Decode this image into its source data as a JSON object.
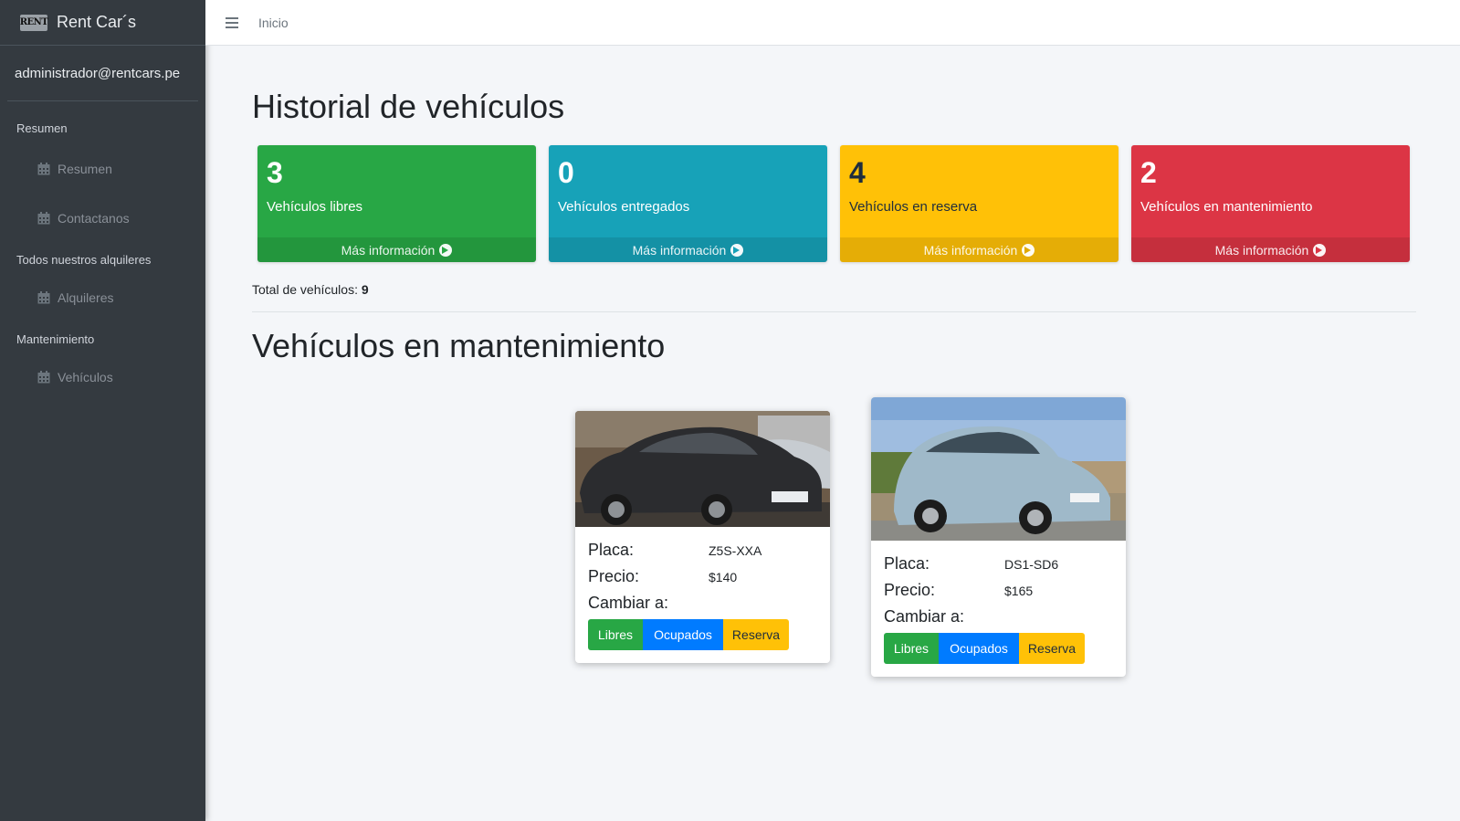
{
  "brand": {
    "logo_text": "RENT",
    "name": "Rent Car´s"
  },
  "user": {
    "email": "administrador@rentcars.pe"
  },
  "nav": {
    "sections": [
      {
        "header": "Resumen",
        "items": [
          {
            "label": "Resumen",
            "icon": "calendar-icon"
          },
          {
            "label": "Contactanos",
            "icon": "calendar-icon"
          }
        ]
      },
      {
        "header": "Todos nuestros alquileres",
        "items": [
          {
            "label": "Alquileres",
            "icon": "calendar-icon"
          }
        ]
      },
      {
        "header": "Mantenimiento",
        "items": [
          {
            "label": "Vehículos",
            "icon": "calendar-icon"
          }
        ]
      }
    ]
  },
  "topbar": {
    "menu_icon": "hamburger-icon",
    "link": "Inicio"
  },
  "page": {
    "title": "Historial de vehículos",
    "stats": [
      {
        "value": "3",
        "label": "Vehículos libres",
        "footer": "Más información",
        "color": "#28a745"
      },
      {
        "value": "0",
        "label": "Vehículos entregados",
        "footer": "Más información",
        "color": "#17a2b8"
      },
      {
        "value": "4",
        "label": "Vehículos en reserva",
        "footer": "Más información",
        "color": "#ffc107"
      },
      {
        "value": "2",
        "label": "Vehículos en mantenimiento",
        "footer": "Más información",
        "color": "#dc3545"
      }
    ],
    "total_label": "Total de vehículos:",
    "total_value": "9",
    "maintenance_title": "Vehículos en mantenimiento"
  },
  "cards": [
    {
      "plate_label": "Placa:",
      "plate": "Z5S-XXA",
      "price_label": "Precio:",
      "price": "$140",
      "change_label": "Cambiar a:",
      "buttons": [
        "Libres",
        "Ocupados",
        "Reserva"
      ],
      "image": "dark-sedan-photo"
    },
    {
      "plate_label": "Placa:",
      "plate": "DS1-SD6",
      "price_label": "Precio:",
      "price": "$165",
      "change_label": "Cambiar a:",
      "buttons": [
        "Libres",
        "Ocupados",
        "Reserva"
      ],
      "image": "light-blue-hatchback-photo"
    }
  ]
}
